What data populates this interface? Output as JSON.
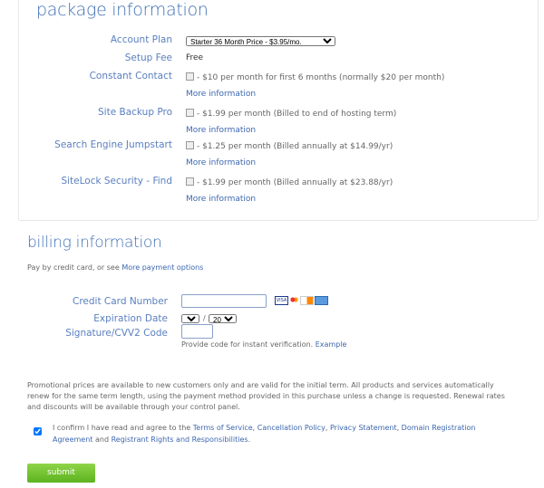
{
  "package": {
    "title": "package information",
    "account_plan_label": "Account Plan",
    "account_plan_value": "Starter 36 Month Price - $3.95/mo.",
    "setup_fee_label": "Setup Fee",
    "setup_fee_value": "Free",
    "addons": [
      {
        "label": "Constant Contact",
        "text": "- $10 per month for first 6 months (normally $20 per month)",
        "more": "More information",
        "checked": false
      },
      {
        "label": "Site Backup Pro",
        "text": "- $1.99 per month (Billed to end of hosting term)",
        "more": "More information",
        "checked": false
      },
      {
        "label": "Search Engine Jumpstart",
        "text": "- $1.25 per month (Billed annually at $14.99/yr)",
        "more": "More information",
        "checked": false
      },
      {
        "label": "SiteLock Security - Find",
        "text": "- $1.99 per month (Billed annually at $23.88/yr)",
        "more": "More information",
        "checked": false
      }
    ]
  },
  "billing": {
    "title": "billing information",
    "pay_text": "Pay by credit card, or see",
    "pay_link": "More payment options",
    "cc_label": "Credit Card Number",
    "cc_value": "",
    "card_icons": [
      "visa-icon",
      "mastercard-icon",
      "discover-icon",
      "amex-icon"
    ],
    "exp_label": "Expiration Date",
    "exp_month": "01",
    "exp_sep": "/",
    "exp_year": "2015",
    "cvv_label": "Signature/CVV2 Code",
    "cvv_value": "",
    "cvv_hint": "Provide code for instant verification.",
    "cvv_link": "Example"
  },
  "legal": {
    "promo": "Promotional prices are available to new customers only and are valid for the initial term. All products and services automatically renew for the same term length, using the payment method provided in this purchase unless a change is requested. Renewal rates and discounts will be available through your control panel.",
    "confirm_text": "I confirm I have read and agree to the",
    "links": [
      "Terms of Service",
      "Cancellation Policy",
      "Privacy Statement",
      "Domain Registration Agreement"
    ],
    "and": "and",
    "last_link": "Registrant Rights and Responsibilities",
    "confirm_checked": true
  },
  "submit_label": "submit"
}
